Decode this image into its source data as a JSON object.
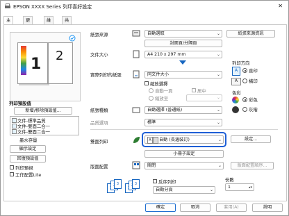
{
  "window": {
    "title": "EPSON XXXX Series 列印喜好設定",
    "close": "✕"
  },
  "tabs": [
    "主選單",
    "更多選項",
    "維護",
    "共用"
  ],
  "preview": {
    "big_number": "1",
    "page2": "2"
  },
  "presets": {
    "title": "列印預設值",
    "add_remove": "新增/移除預設值...",
    "items": [
      "文件-標準品質",
      "文件-雙面二合一",
      "文件-雙面二合一"
    ],
    "ink_level": "墨水存量",
    "show_settings": "顯示設定",
    "reset": "回復預設值",
    "preview_chk": "列印預視",
    "lite_chk": "工作配置Lite"
  },
  "source": {
    "label": "紙張來源",
    "value": "自動選取",
    "btn": "紙張來源資訊",
    "sub_btn": "封面頁/分隔頁"
  },
  "doc_size": {
    "label": "文件大小",
    "value": "A4 210 x 297 mm"
  },
  "output_paper": {
    "label": "實際列印的紙張",
    "value": "同文件大小",
    "chk": "縮放選擇",
    "opt1": "自動一頁",
    "opt2": "居中",
    "opt3": "縮放至"
  },
  "orientation": {
    "title": "列印方向",
    "opt1": "直印",
    "opt2": "橫印"
  },
  "paper_type": {
    "label": "紙張種類",
    "value": "自動選擇 (普通紙)"
  },
  "quality": {
    "label": "品質選項",
    "value": "標準"
  },
  "color": {
    "title": "色彩",
    "opt1": "彩色",
    "opt2": "灰階"
  },
  "duplex": {
    "label": "雙面列印",
    "value": "自動 (長邊裝訂)",
    "settings_btn": "設定...",
    "booklet_btn": "小冊子設定"
  },
  "multipage": {
    "label": "版面配置",
    "value": "關閉",
    "order_btn": "版面配置順序..."
  },
  "copies": {
    "label": "份數",
    "value": "1",
    "reverse_chk": "反序列印",
    "collate": "自動分頁"
  },
  "footer": {
    "ok": "確定",
    "cancel": "取消",
    "apply": "套用(A)",
    "help": "說明"
  }
}
